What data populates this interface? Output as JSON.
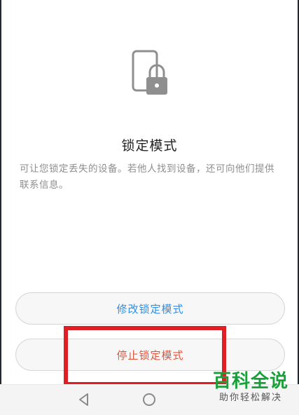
{
  "lock_mode": {
    "title": "锁定模式",
    "description": "可让您锁定丢失的设备。若他人找到设备，还可向他们提供联系信息。",
    "icon": "phone-lock-icon"
  },
  "buttons": {
    "modify_label": "修改锁定模式",
    "stop_label": "停止锁定模式"
  },
  "navbar": {
    "back_icon": "back-triangle-icon",
    "home_icon": "home-circle-icon"
  },
  "watermark": {
    "main": "百科全说",
    "sub": "助你轻松解决"
  },
  "colors": {
    "modify_text": "#2f8ee6",
    "stop_text": "#e2543c",
    "highlight": "#e01e24",
    "watermark_green": "#1aa03a"
  }
}
